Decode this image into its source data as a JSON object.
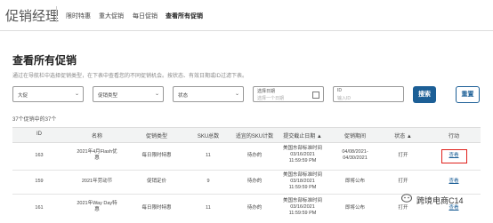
{
  "app": {
    "title": "促销经理"
  },
  "nav": [
    {
      "label": "限时特惠",
      "active": false
    },
    {
      "label": "重大促销",
      "active": false
    },
    {
      "label": "每日促销",
      "active": false
    },
    {
      "label": "查看所有促销",
      "active": true
    }
  ],
  "page": {
    "title": "查看所有促销",
    "description": "通过在导航栏中选择促销类型，在下表中查看您的不同促销机会。按状态、有效日期或ID过滤下表。",
    "count_text": "37个促销中的37个"
  },
  "filters": {
    "f1": "大促",
    "f2": "促销类型",
    "f3": "状态",
    "date_label": "选择日期",
    "date_placeholder": "选择一个日期",
    "id_label": "ID",
    "id_placeholder": "输入ID",
    "search_label": "搜索",
    "reset_label": "重置"
  },
  "table": {
    "headers": [
      "ID",
      "名称",
      "促销类型",
      "SKU总数",
      "适宜的SKU计数",
      "提交截止日期 ▲",
      "促销期间",
      "状态 ▲",
      "行动"
    ],
    "rows": [
      {
        "id": "163",
        "name": [
          "2021年4月Flash优",
          "惠"
        ],
        "type": "每日限时特惠",
        "sku_total": "11",
        "eligible": "待办的",
        "deadline": [
          "美国东部标准时间",
          "03/16/2021",
          "11:59:59 PM"
        ],
        "period": [
          "04/08/2021-",
          "04/30/2021"
        ],
        "status": "打开",
        "action": "查看"
      },
      {
        "id": "159",
        "name": [
          "2021年劳动节"
        ],
        "type": "促销定价",
        "sku_total": "9",
        "eligible": "待办的",
        "deadline": [
          "美国东部标准时间",
          "03/18/2021",
          "11:59:59 PM"
        ],
        "period": [
          "即将公布"
        ],
        "status": "打开",
        "action": "查看"
      },
      {
        "id": "161",
        "name": [
          "2021年Way Day特",
          "惠"
        ],
        "type": "每日限时特惠",
        "sku_total": "11",
        "eligible": "待办的",
        "deadline": [
          "美国东部标准时间",
          "03/16/2021",
          "11:59:59 PM"
        ],
        "period": [
          "即将公布"
        ],
        "status": "打开",
        "action": "查看"
      }
    ]
  },
  "watermark": "跨境电商C14",
  "colors": {
    "accent": "#1c5f96",
    "highlight": "#e0201b"
  }
}
